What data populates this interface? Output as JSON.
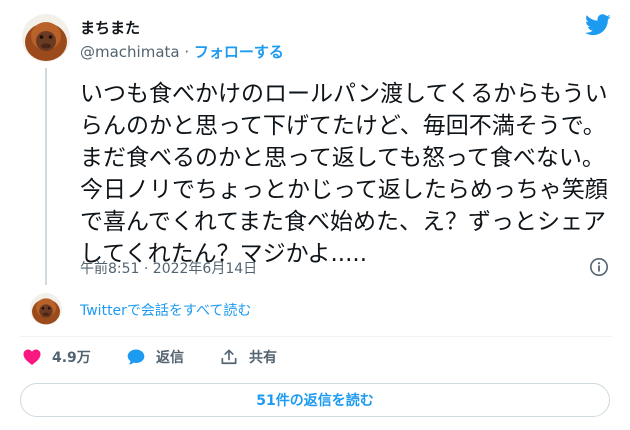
{
  "tweet": {
    "display_name": "まちまた",
    "handle": "@machimata",
    "separator": " · ",
    "follow_label": "フォローする",
    "text_lines": [
      "いつも食べかけのロールパン渡してくるからもうい",
      "らんのかと思って下げてたけど、毎回不満そうで。",
      "まだ食べるのかと思って返しても怒って食べない。",
      "今日ノリでちょっとかじって返したらめっちゃ笑顔",
      "で喜んでくれてまた食べ始めた、え？ずっとシェア",
      "してくれたん？マジかよ....."
    ],
    "timestamp": "午前8:51 · 2022年6月14日",
    "conversation_link": "Twitterで会話をすべて読む"
  },
  "actions": {
    "like_count": "4.9万",
    "reply_label": "返信",
    "share_label": "共有"
  },
  "footer": {
    "replies_button": "51件の返信を読む"
  },
  "icons": {
    "brand": "twitter-bird-icon",
    "info": "info-icon",
    "like": "heart-icon",
    "reply": "speech-bubble-icon",
    "share": "share-upload-icon"
  },
  "colors": {
    "accent": "#1d9bf0",
    "like": "#f91880",
    "text": "#0f1419",
    "secondary": "#536471"
  }
}
